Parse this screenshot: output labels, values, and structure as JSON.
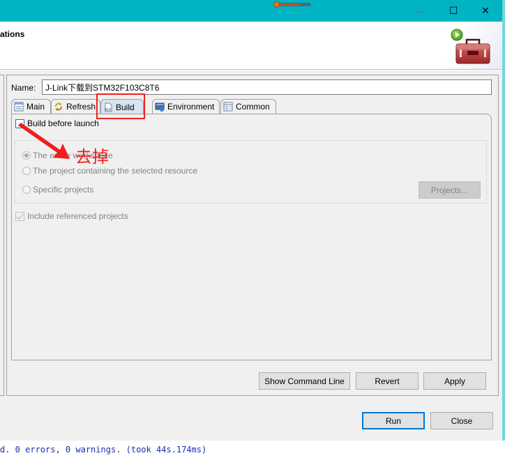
{
  "window": {
    "minimize_glyph": "—",
    "maximize_glyph": "☐",
    "close_glyph": "✕"
  },
  "header": {
    "title": "ations"
  },
  "config": {
    "name_label": "Name:",
    "name_value": "J-Link下载到STM32F103C8T6"
  },
  "tabs": [
    {
      "label": "Main",
      "icon": "main-tab-icon",
      "active": false
    },
    {
      "label": "Refresh",
      "icon": "refresh-icon",
      "active": false
    },
    {
      "label": "Build",
      "icon": "build-binary-icon",
      "active": true
    },
    {
      "label": "Environment",
      "icon": "environment-icon",
      "active": false
    },
    {
      "label": "Common",
      "icon": "common-table-icon",
      "active": false
    }
  ],
  "build_tab": {
    "build_before_launch": {
      "label": "Build before launch",
      "checked": false
    },
    "scope_options": [
      {
        "label": "The entire workspace",
        "selected": true,
        "enabled": false
      },
      {
        "label": "The project containing the selected resource",
        "selected": false,
        "enabled": false
      },
      {
        "label": "Specific projects",
        "selected": false,
        "enabled": false
      }
    ],
    "projects_button": "Projects...",
    "include_referenced": {
      "label": "Include referenced projects",
      "checked": true,
      "enabled": false
    }
  },
  "buttons": {
    "show_command_line": "Show Command Line",
    "revert": "Revert",
    "apply": "Apply",
    "run": "Run",
    "close": "Close"
  },
  "console": {
    "status_text": "d. 0 errors, 0 warnings. (took 44s.174ms)"
  },
  "annotation": {
    "text": "去掉",
    "color": "#f41c1c"
  }
}
